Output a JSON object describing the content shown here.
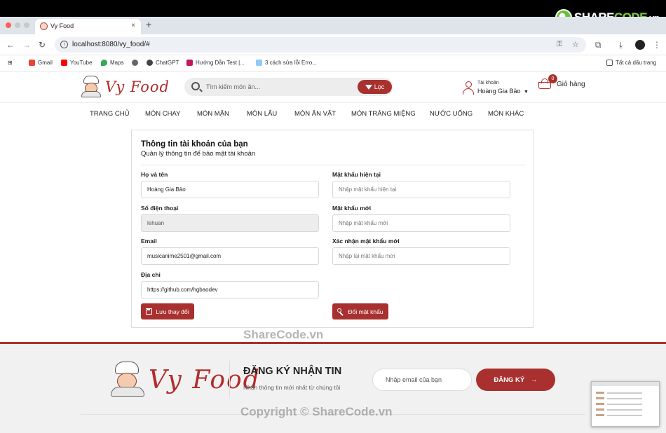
{
  "browser": {
    "tab_title": "Vy Food",
    "tab_close": "×",
    "new_tab": "+",
    "url": "localhost:8080/vy_food/#",
    "bookmarks": [
      "Gmail",
      "YouTube",
      "Maps",
      "ChatGPT",
      "Hướng Dẫn Test |...",
      "3 cách sửa lỗi Erro..."
    ],
    "all_bookmarks": "Tất cả dấu trang"
  },
  "watermark": {
    "logo_prefix": "SHARE",
    "logo_suffix": "CODE",
    "logo_domain": ".vn",
    "center": "ShareCode.vn",
    "footer": "Copyright © ShareCode.vn"
  },
  "header": {
    "logo": "Vy Food",
    "search_placeholder": "Tìm kiếm món ăn...",
    "filter_label": "Lọc",
    "account_label": "Tài khoản",
    "account_name": "Hoàng Gia Bảo",
    "cart_count": "0",
    "cart_label": "Giỏ hàng"
  },
  "nav": {
    "items": [
      "TRANG CHỦ",
      "MÓN CHAY",
      "MÓN MẶN",
      "MÓN LẨU",
      "MÓN ĂN VẶT",
      "MÓN TRÁNG MIỆNG",
      "NƯỚC UỐNG",
      "MÓN KHÁC"
    ]
  },
  "account_form": {
    "title": "Thông tin tài khoản của bạn",
    "subtitle": "Quản lý thông tin để bảo mật tài khoản",
    "fullname_label": "Họ và tên",
    "fullname_value": "Hoàng Gia Bảo",
    "phone_label": "Số điện thoại",
    "phone_value": "lehuan",
    "email_label": "Email",
    "email_value": "musicanime2501@gmail.com",
    "address_label": "Địa chỉ",
    "address_value": "https://github.com/hgbaodev",
    "save_label": "Lưu thay đổi",
    "current_pw_label": "Mật khẩu hiện tại",
    "current_pw_placeholder": "Nhập mật khẩu hiện tại",
    "new_pw_label": "Mật khẩu mới",
    "new_pw_placeholder": "Nhập mật khẩu mới",
    "confirm_pw_label": "Xác nhận mật khẩu mới",
    "confirm_pw_placeholder": "Nhập lại mật khẩu mới",
    "change_pw_label": "Đổi mật khẩu"
  },
  "footer": {
    "logo": "Vy Food",
    "title": "ĐĂNG KÝ NHẬN TIN",
    "subtitle": "Nhận thông tin mới nhất từ chúng tôi",
    "email_placeholder": "Nhập email của bạn",
    "subscribe_label": "ĐĂNG KÝ",
    "arrow": "→"
  },
  "colors": {
    "brand": "#a8312f",
    "logo": "#b32b2b"
  }
}
